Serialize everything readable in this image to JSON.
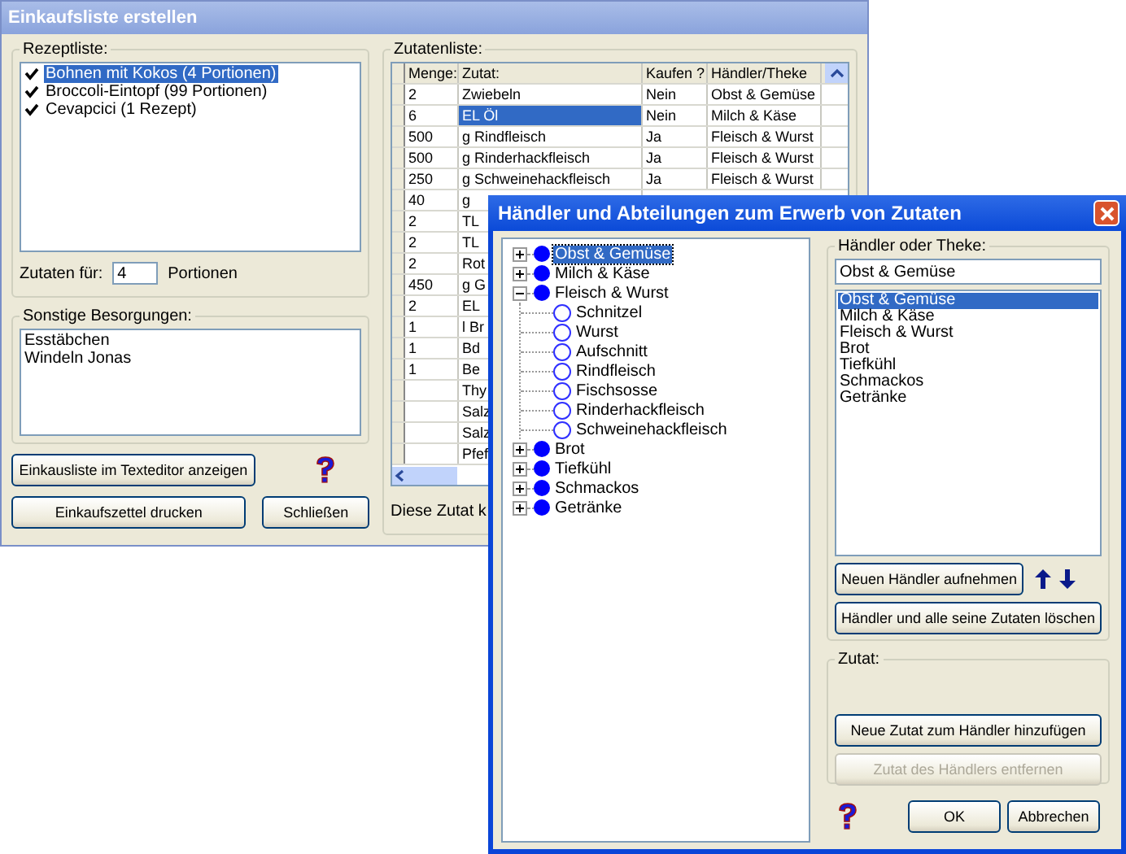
{
  "main_window": {
    "title": "Einkaufsliste erstellen",
    "recipes": {
      "label": "Rezeptliste:",
      "items": [
        {
          "label": "Bohnen mit Kokos (4 Portionen)",
          "checked": true,
          "selected": true
        },
        {
          "label": "Broccoli-Eintopf (99 Portionen)",
          "checked": true,
          "selected": false
        },
        {
          "label": "Cevapcici (1 Rezept)",
          "checked": true,
          "selected": false
        }
      ],
      "portions_label": "Zutaten für:",
      "portions_value": "4",
      "portions_unit": "Portionen"
    },
    "other": {
      "label": "Sonstige Besorgungen:",
      "lines": [
        "Esstäbchen",
        "Windeln Jonas"
      ]
    },
    "buttons": {
      "editor": "Einkausliste im Texteditor anzeigen",
      "print": "Einkaufszettel drucken",
      "close": "Schließen"
    },
    "ingredients": {
      "label": "Zutatenliste:",
      "columns": [
        "Menge:",
        "Zutat:",
        "Kaufen ?",
        "Händler/Theke"
      ],
      "rows": [
        {
          "cells": [
            "2",
            "Zwiebeln",
            "Nein",
            "Obst & Gemüse"
          ],
          "selected": false
        },
        {
          "cells": [
            "6",
            "EL Öl",
            "Nein",
            "Milch & Käse"
          ],
          "selected": true
        },
        {
          "cells": [
            "500",
            "g Rindfleisch",
            "Ja",
            "Fleisch & Wurst"
          ],
          "selected": false
        },
        {
          "cells": [
            "500",
            "g Rinderhackfleisch",
            "Ja",
            "Fleisch & Wurst"
          ],
          "selected": false
        },
        {
          "cells": [
            "250",
            "g Schweinehackfleisch",
            "Ja",
            "Fleisch & Wurst"
          ],
          "selected": false
        },
        {
          "cells": [
            "40",
            "g"
          ],
          "selected": false
        },
        {
          "cells": [
            "2",
            "TL"
          ],
          "selected": false
        },
        {
          "cells": [
            "2",
            "TL"
          ],
          "selected": false
        },
        {
          "cells": [
            "2",
            "Rot"
          ],
          "selected": false
        },
        {
          "cells": [
            "450",
            "g G"
          ],
          "selected": false
        },
        {
          "cells": [
            "2",
            "EL"
          ],
          "selected": false
        },
        {
          "cells": [
            "1",
            "l Br"
          ],
          "selected": false
        },
        {
          "cells": [
            "1",
            "Bd"
          ],
          "selected": false
        },
        {
          "cells": [
            "1",
            "Be"
          ],
          "selected": false
        },
        {
          "cells": [
            "",
            "Thy"
          ],
          "selected": false
        },
        {
          "cells": [
            "",
            "Salz"
          ],
          "selected": false
        },
        {
          "cells": [
            "",
            "Salz"
          ],
          "selected": false
        },
        {
          "cells": [
            "",
            "Pfef"
          ],
          "selected": false
        }
      ],
      "status": "Diese Zutat k"
    }
  },
  "dialog": {
    "title": "Händler und Abteilungen zum Erwerb von Zutaten",
    "tree": [
      {
        "label": "Obst & Gemüse",
        "expanded": false,
        "selected": true
      },
      {
        "label": "Milch & Käse",
        "expanded": false,
        "selected": false
      },
      {
        "label": "Fleisch & Wurst",
        "expanded": true,
        "selected": false,
        "children": [
          {
            "label": "Schnitzel"
          },
          {
            "label": "Wurst"
          },
          {
            "label": "Aufschnitt"
          },
          {
            "label": "Rindfleisch"
          },
          {
            "label": "Fischsosse"
          },
          {
            "label": "Rinderhackfleisch"
          },
          {
            "label": "Schweinehackfleisch"
          }
        ]
      },
      {
        "label": "Brot",
        "expanded": false,
        "selected": false
      },
      {
        "label": "Tiefkühl",
        "expanded": false,
        "selected": false
      },
      {
        "label": "Schmackos",
        "expanded": false,
        "selected": false
      },
      {
        "label": "Getränke",
        "expanded": false,
        "selected": false
      }
    ],
    "vendor_group": "Händler oder Theke:",
    "vendor_value": "Obst & Gemüse",
    "vendors": [
      {
        "label": "Obst & Gemüse",
        "selected": true
      },
      {
        "label": "Milch & Käse",
        "selected": false
      },
      {
        "label": "Fleisch & Wurst",
        "selected": false
      },
      {
        "label": "Brot",
        "selected": false
      },
      {
        "label": "Tiefkühl",
        "selected": false
      },
      {
        "label": "Schmackos",
        "selected": false
      },
      {
        "label": "Getränke",
        "selected": false
      }
    ],
    "add_vendor": "Neuen Händler aufnehmen",
    "delete_vendor": "Händler und alle seine Zutaten löschen",
    "ingredient_group": "Zutat:",
    "ingredient_buttons": [
      {
        "label": "Neue Zutat zum Händler hinzufügen",
        "disabled": false
      },
      {
        "label": "Zutat des Händlers entfernen",
        "disabled": true
      }
    ],
    "ok": "OK",
    "cancel": "Abbrechen"
  }
}
